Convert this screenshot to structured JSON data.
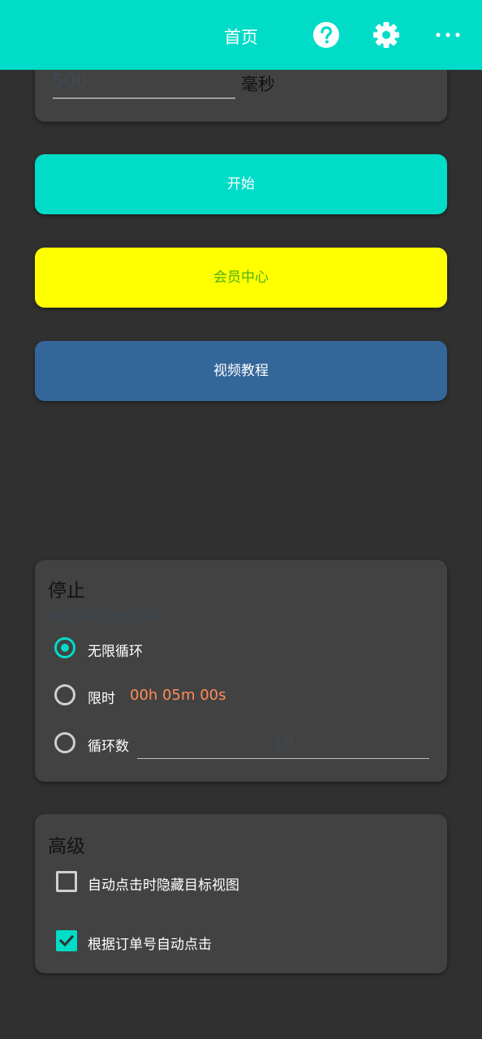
{
  "header": {
    "title": "首页",
    "icons": [
      "help-icon",
      "gear-icon",
      "more-icon"
    ],
    "color": "#00dcc8"
  },
  "interval": {
    "value": "500",
    "unit": "毫秒"
  },
  "buttons": {
    "start": "开始",
    "member": "会员中心",
    "video": "视频教程"
  },
  "stop": {
    "title": "停止",
    "subtitle": "停止自动点击的条件",
    "options": [
      {
        "label": "无限循环",
        "checked": true
      },
      {
        "label": "限时",
        "value": "00h 05m 00s",
        "checked": false
      },
      {
        "label": "循环数",
        "value": "10",
        "checked": false
      }
    ]
  },
  "advanced": {
    "title": "高级",
    "options": [
      {
        "label": "自动点击时隐藏目标视图",
        "checked": false
      },
      {
        "label": "根据订单号自动点击",
        "checked": true
      }
    ]
  },
  "colors": {
    "accent": "#00dcc8",
    "member_bg": "#ffff00",
    "video_bg": "#336699",
    "time_text": "#ff8c5a"
  }
}
